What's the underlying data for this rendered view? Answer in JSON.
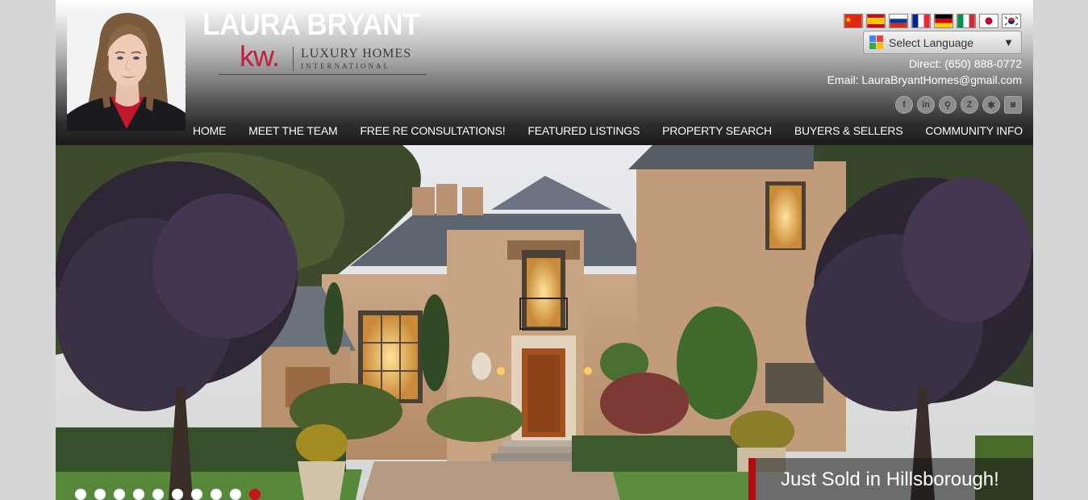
{
  "brand": {
    "name": "LAURA BRYANT",
    "kw_mark": "kw.",
    "division_line1": "LUXURY HOMES",
    "division_line2": "INTERNATIONAL",
    "accent_color": "#c0213a"
  },
  "language": {
    "flags": [
      "china-flag",
      "spain-flag",
      "russia-flag",
      "france-flag",
      "germany-flag",
      "italy-flag",
      "japan-flag",
      "korea-flag"
    ],
    "select_label": "Select Language",
    "arrow": "▼"
  },
  "contact": {
    "direct": "Direct: (650) 888-0772",
    "email": "Email: LauraBryantHomes@gmail.com"
  },
  "socials": [
    {
      "name": "facebook-icon",
      "glyph": "f"
    },
    {
      "name": "linkedin-icon",
      "glyph": "in"
    },
    {
      "name": "map-pin-icon",
      "glyph": "⚲"
    },
    {
      "name": "zillow-icon",
      "glyph": "Z"
    },
    {
      "name": "yelp-icon",
      "glyph": "✱"
    },
    {
      "name": "instagram-icon",
      "glyph": "◙"
    }
  ],
  "nav": [
    "HOME",
    "MEET THE TEAM",
    "FREE RE CONSULTATIONS!",
    "FEATURED LISTINGS",
    "PROPERTY SEARCH",
    "BUYERS & SELLERS",
    "COMMUNITY INFO"
  ],
  "hero": {
    "caption": "Just Sold in Hillsborough!",
    "slide_count": 10,
    "active_slide": 10,
    "caption_accent": "#b30d14"
  }
}
